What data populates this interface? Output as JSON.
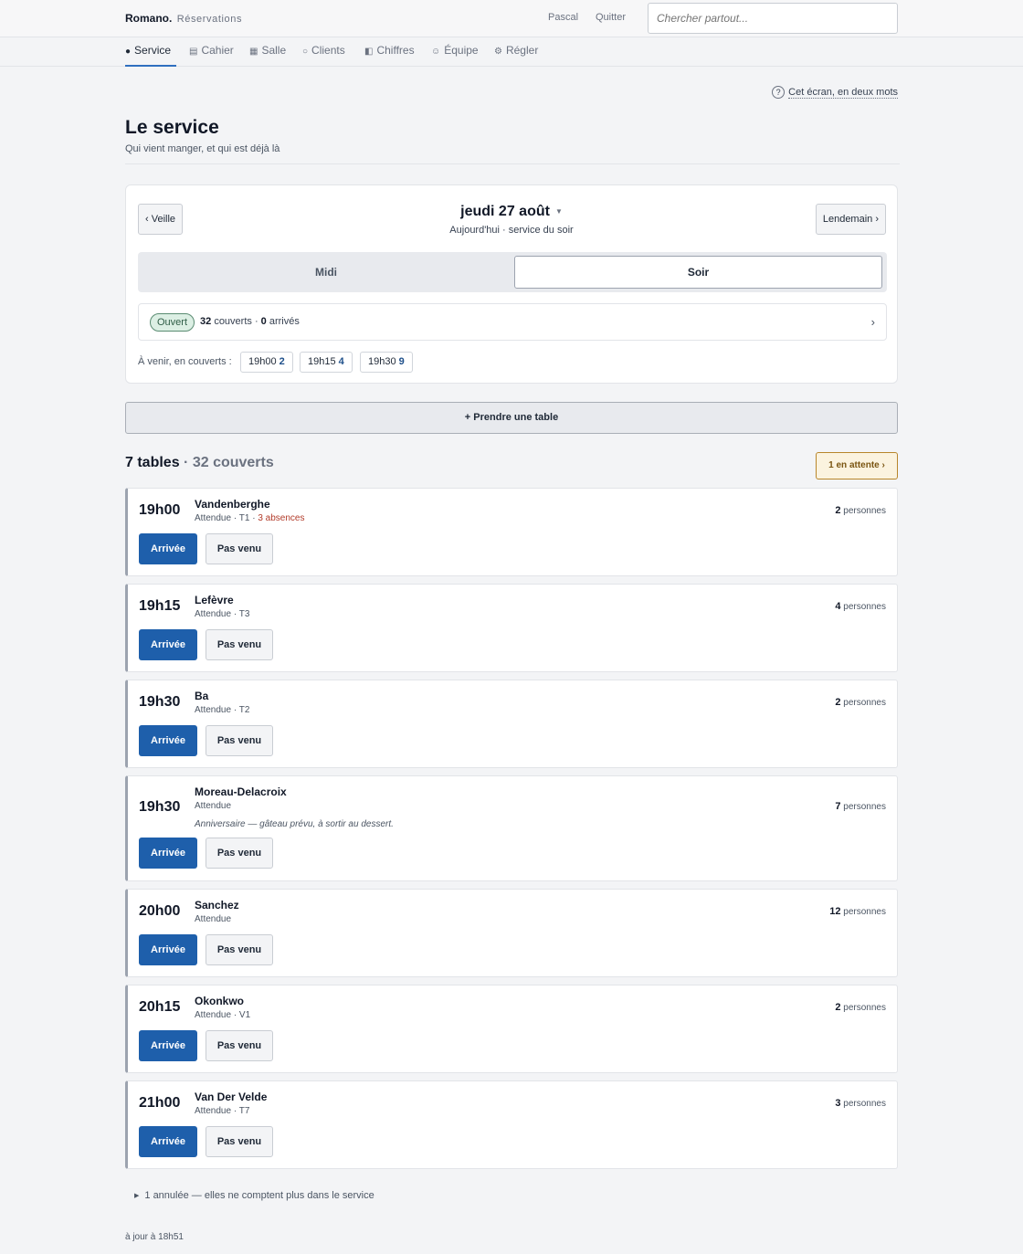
{
  "header": {
    "brand": "Romano.",
    "brand_sub": "Réservations",
    "user": "Pascal",
    "logout": "Quitter",
    "search_placeholder": "Chercher partout..."
  },
  "nav": [
    {
      "label": "Service",
      "icon": "bullet-icon"
    },
    {
      "label": "Cahier",
      "icon": "list-icon"
    },
    {
      "label": "Salle",
      "icon": "grid-icon"
    },
    {
      "label": "Clients",
      "icon": "circle-icon"
    },
    {
      "label": "Chiffres",
      "icon": "half-square-icon"
    },
    {
      "label": "Équipe",
      "icon": "smile-icon"
    },
    {
      "label": "Régler",
      "icon": "gear-icon"
    }
  ],
  "help": {
    "icon": "question-icon",
    "label": "Cet écran, en deux mots"
  },
  "page": {
    "title": "Le service",
    "subtitle": "Qui vient manger, et qui est déjà là"
  },
  "day": {
    "prev": "‹ Veille",
    "next": "Lendemain ›",
    "date": "jeudi 27 août",
    "sub": "Aujourd'hui · service du soir",
    "services": [
      "Midi",
      "Soir"
    ],
    "selected": "Soir",
    "status_badge": "Ouvert",
    "covers": "32",
    "covers_label": "couverts ·",
    "arrived": "0",
    "arrived_label": "arrivés",
    "upcoming_label": "À venir, en couverts :",
    "upcoming": [
      {
        "time": "19h00",
        "count": "2"
      },
      {
        "time": "19h15",
        "count": "4"
      },
      {
        "time": "19h30",
        "count": "9"
      }
    ]
  },
  "take_table": "+ Prendre une table",
  "list": {
    "tables": "7 tables",
    "covers": "· 32 couverts",
    "waiting": "1 en attente ›"
  },
  "reservations": [
    {
      "time": "19h00",
      "name": "Vandenberghe",
      "status": "Attendue",
      "table": "· T1 ·",
      "warning": "3 absences",
      "note": "",
      "people": "2",
      "people_label": "personnes"
    },
    {
      "time": "19h15",
      "name": "Lefèvre",
      "status": "Attendue",
      "table": "· T3",
      "warning": "",
      "note": "",
      "people": "4",
      "people_label": "personnes"
    },
    {
      "time": "19h30",
      "name": "Ba",
      "status": "Attendue",
      "table": "· T2",
      "warning": "",
      "note": "",
      "people": "2",
      "people_label": "personnes"
    },
    {
      "time": "19h30",
      "name": "Moreau-Delacroix",
      "status": "Attendue",
      "table": "",
      "warning": "",
      "note": "Anniversaire — gâteau prévu, à sortir au dessert.",
      "people": "7",
      "people_label": "personnes"
    },
    {
      "time": "20h00",
      "name": "Sanchez",
      "status": "Attendue",
      "table": "",
      "warning": "",
      "note": "",
      "people": "12",
      "people_label": "personnes"
    },
    {
      "time": "20h15",
      "name": "Okonkwo",
      "status": "Attendue",
      "table": "· V1",
      "warning": "",
      "note": "",
      "people": "2",
      "people_label": "personnes"
    },
    {
      "time": "21h00",
      "name": "Van Der Velde",
      "status": "Attendue",
      "table": "· T7",
      "warning": "",
      "note": "",
      "people": "3",
      "people_label": "personnes"
    }
  ],
  "actions": {
    "arrived": "Arrivée",
    "noshow": "Pas venu"
  },
  "cancelled": "1 annulée — elles ne comptent plus dans le service",
  "updated": "à jour à 18h51"
}
